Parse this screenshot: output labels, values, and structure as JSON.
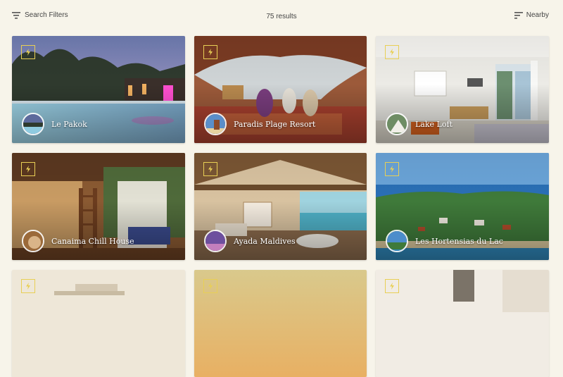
{
  "toolbar": {
    "filters_label": "Search Filters",
    "results_label": "75 results",
    "sort_label": "Nearby"
  },
  "colors": {
    "background": "#f7f4ea",
    "badge_accent": "#e8cf55"
  },
  "listings": [
    {
      "name": "Le Pakok"
    },
    {
      "name": "Paradis Plage Resort"
    },
    {
      "name": "Lake Loft"
    },
    {
      "name": "Canaima Chill House"
    },
    {
      "name": "Ayada Maldives"
    },
    {
      "name": "Les Hortensias du Lac"
    },
    {
      "name": ""
    },
    {
      "name": ""
    },
    {
      "name": ""
    }
  ],
  "icons": {
    "filters": "filter-lines-icon",
    "sort": "sort-lines-icon",
    "badge": "lightning-bolt-icon"
  }
}
